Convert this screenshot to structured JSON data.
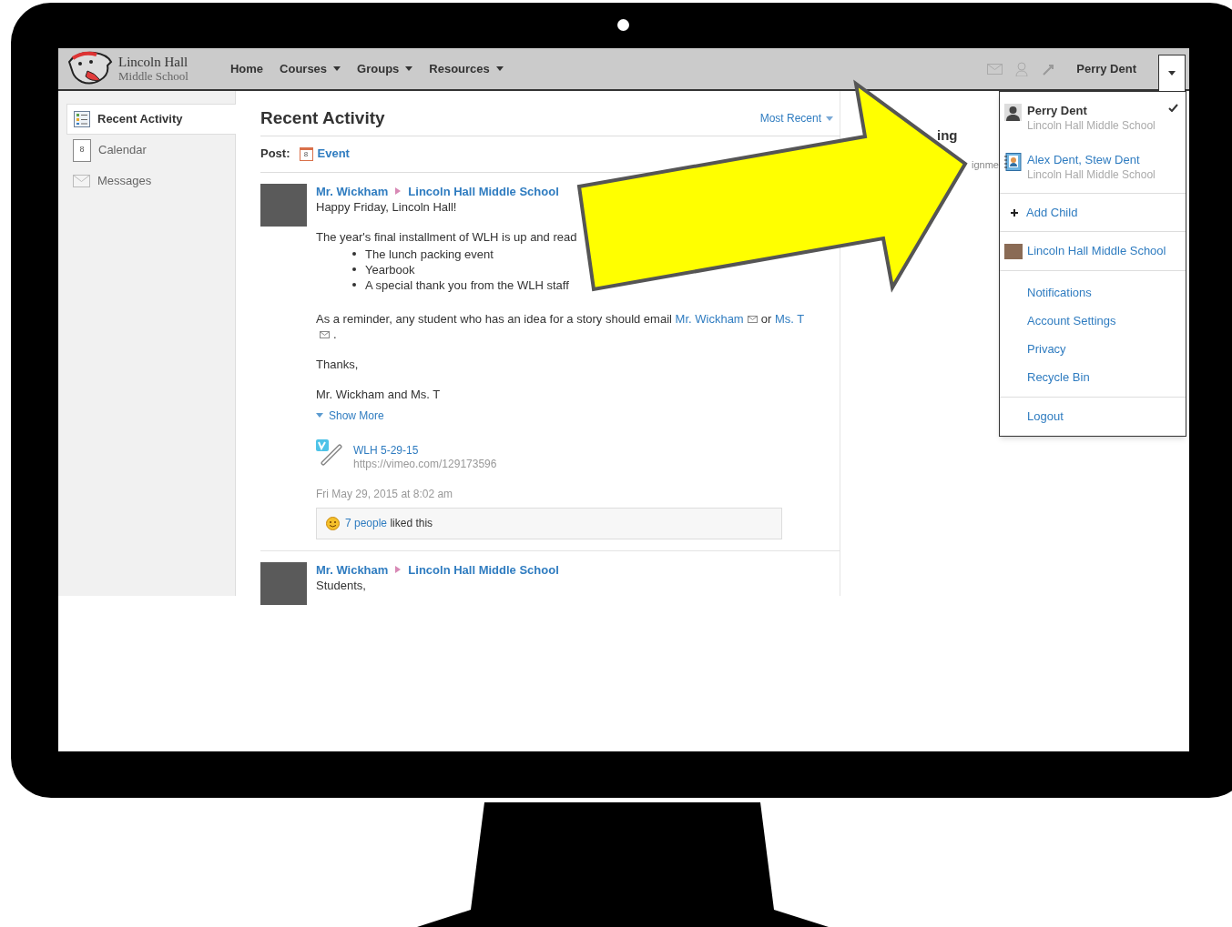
{
  "brand": {
    "name": "Lincoln Hall",
    "subtitle": "Middle School"
  },
  "nav": [
    {
      "label": "Home",
      "dropdown": false
    },
    {
      "label": "Courses",
      "dropdown": true
    },
    {
      "label": "Groups",
      "dropdown": true
    },
    {
      "label": "Resources",
      "dropdown": true
    }
  ],
  "user_name": "Perry Dent",
  "sidebar": {
    "items": [
      {
        "label": "Recent Activity",
        "kind": "activity",
        "selected": true
      },
      {
        "label": "Calendar",
        "kind": "calendar",
        "day": "8",
        "selected": false
      },
      {
        "label": "Messages",
        "kind": "messages",
        "selected": false
      }
    ]
  },
  "main": {
    "title": "Recent Activity",
    "sort": "Most Recent",
    "post_label": "Post:",
    "post_option": "Event",
    "calendar_day": "8",
    "posts": [
      {
        "author": "Mr. Wickham",
        "group": "Lincoln Hall Middle School",
        "greeting": "Happy Friday, Lincoln Hall!",
        "intro": "The year's final installment of WLH is up and read",
        "bullets": [
          "The lunch packing event",
          "Yearbook",
          "A special thank you from the WLH staff"
        ],
        "reminder": {
          "text": "As a reminder, any student who has an idea for a story should email",
          "link1": "Mr. Wickham",
          "joiner": "or",
          "link2": "Ms. T",
          "end": "."
        },
        "thanks": "Thanks,",
        "signature": "Mr. Wickham and Ms. T",
        "show_more": "Show More",
        "attachment": {
          "title": "WLH 5-29-15",
          "url": "https://vimeo.com/129173596"
        },
        "timestamp": "Fri May 29, 2015 at 8:02 am",
        "likes": {
          "count": "7 people",
          "text": "liked this"
        }
      },
      {
        "author": "Mr. Wickham",
        "group": "Lincoln Hall Middle School",
        "greeting": "Students,"
      }
    ]
  },
  "right_panel": {
    "heading": "ing",
    "snippet": "ignme"
  },
  "dropdown": {
    "accounts": [
      {
        "name": "Perry Dent",
        "school": "Lincoln Hall Middle School",
        "kind": "person",
        "selected": true
      },
      {
        "name": "Alex Dent, Stew Dent",
        "school": "Lincoln Hall Middle School",
        "kind": "children",
        "selected": false
      }
    ],
    "add_child": "Add Child",
    "school": "Lincoln Hall Middle School",
    "links": [
      "Notifications",
      "Account Settings",
      "Privacy",
      "Recycle Bin"
    ],
    "logout": "Logout"
  }
}
